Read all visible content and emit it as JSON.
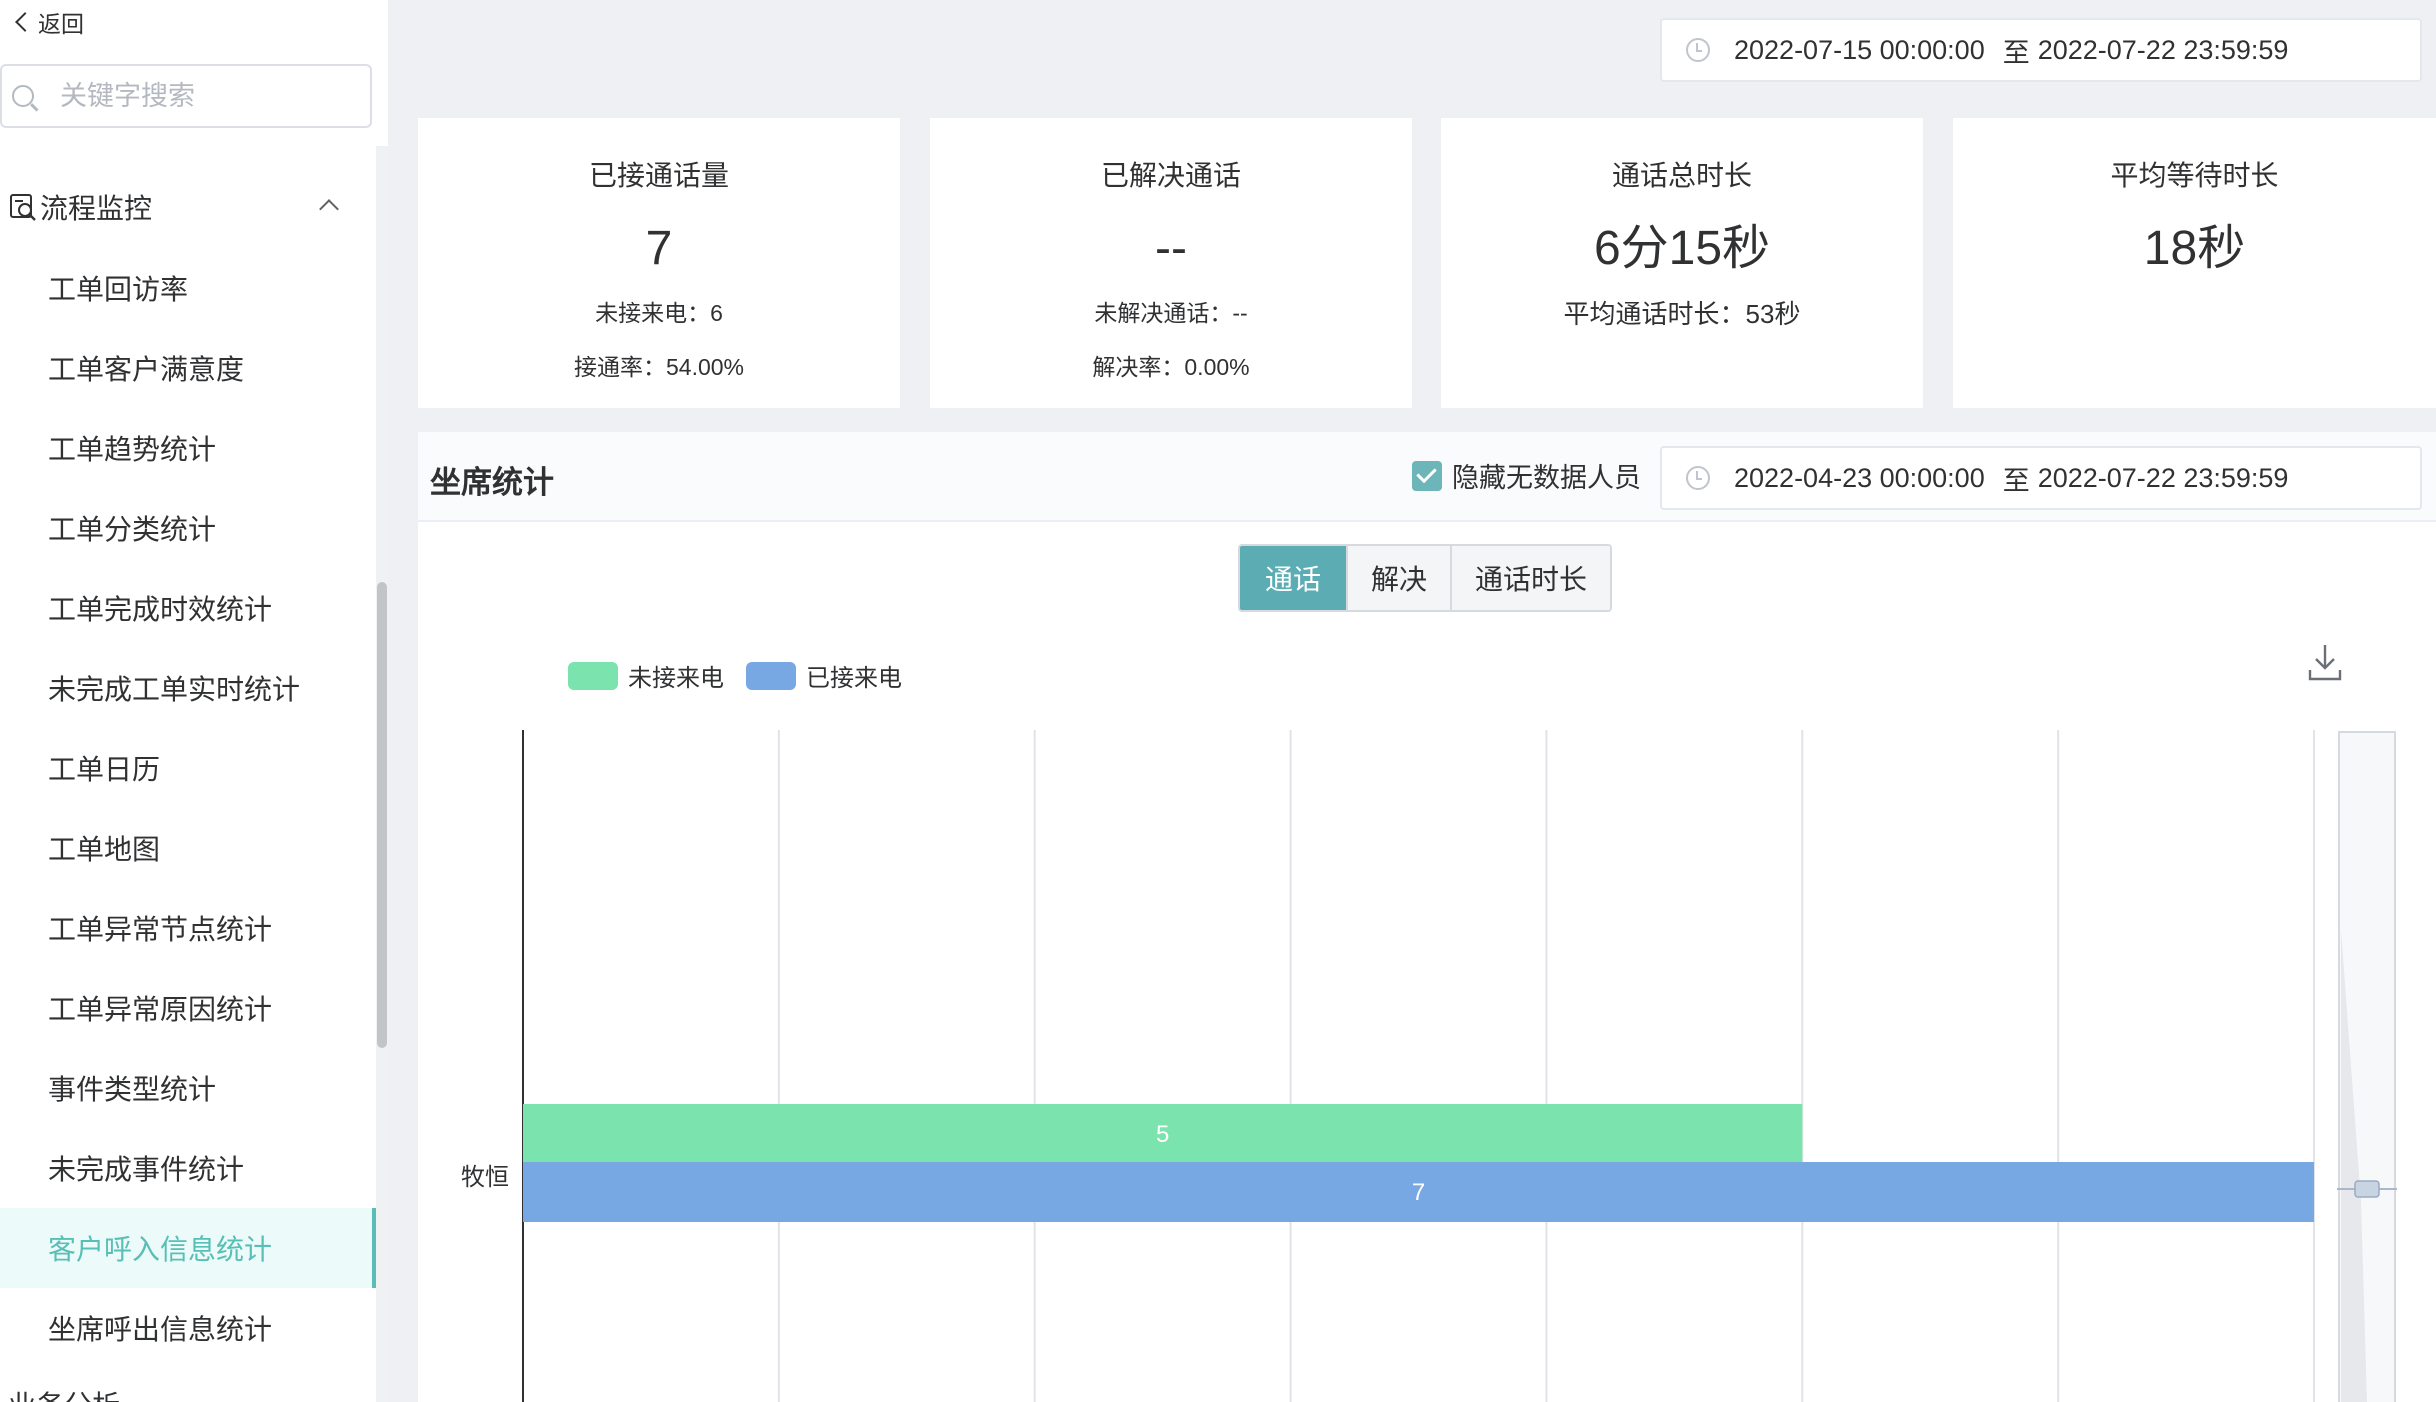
{
  "sidebar": {
    "back_label": "返回",
    "search_placeholder": "关键字搜索",
    "group_title": "流程监控",
    "items": [
      {
        "label": "工单回访率"
      },
      {
        "label": "工单客户满意度"
      },
      {
        "label": "工单趋势统计"
      },
      {
        "label": "工单分类统计"
      },
      {
        "label": "工单完成时效统计"
      },
      {
        "label": "未完成工单实时统计"
      },
      {
        "label": "工单日历"
      },
      {
        "label": "工单地图"
      },
      {
        "label": "工单异常节点统计"
      },
      {
        "label": "工单异常原因统计"
      },
      {
        "label": "事件类型统计"
      },
      {
        "label": "未完成事件统计"
      },
      {
        "label": "客户呼入信息统计",
        "active": true
      },
      {
        "label": "坐席呼出信息统计"
      }
    ],
    "next_group_title": "业务分析"
  },
  "top_range": {
    "start": "2022-07-15 00:00:00",
    "separator": "至",
    "end": "2022-07-22 23:59:59"
  },
  "cards": {
    "answered": {
      "title": "已接通话量",
      "value": "7",
      "sub1": "未接来电：6",
      "sub2": "接通率：54.00%"
    },
    "resolved": {
      "title": "已解决通话",
      "value": "--",
      "sub1": "未解决通话：--",
      "sub2": "解决率：0.00%"
    },
    "duration": {
      "title": "通话总时长",
      "value": "6分15秒",
      "sub1": "平均通话时长：53秒"
    },
    "wait": {
      "title": "平均等待时长",
      "value": "18秒"
    }
  },
  "agent_stats": {
    "title": "坐席统计",
    "hide_empty_label": "隐藏无数据人员",
    "hide_empty_checked": true,
    "range": {
      "start": "2022-04-23 00:00:00",
      "separator": "至",
      "end": "2022-07-22 23:59:59"
    },
    "tabs": [
      {
        "label": "通话",
        "active": true
      },
      {
        "label": "解决",
        "active": false
      },
      {
        "label": "通话时长",
        "active": false
      }
    ]
  },
  "colors": {
    "accent": "#57bfb6",
    "tab_active": "#5bacb3",
    "series_missed": "#7be3ae",
    "series_answered": "#78a8e3"
  },
  "chart_data": {
    "type": "bar",
    "orientation": "horizontal",
    "categories": [
      "牧恒"
    ],
    "series": [
      {
        "name": "未接来电",
        "values": [
          5
        ],
        "color": "#7be3ae"
      },
      {
        "name": "已接来电",
        "values": [
          7
        ],
        "color": "#78a8e3"
      }
    ],
    "xlim": [
      0,
      7
    ],
    "grid": true,
    "legend": "top-left",
    "data_labels": true
  }
}
